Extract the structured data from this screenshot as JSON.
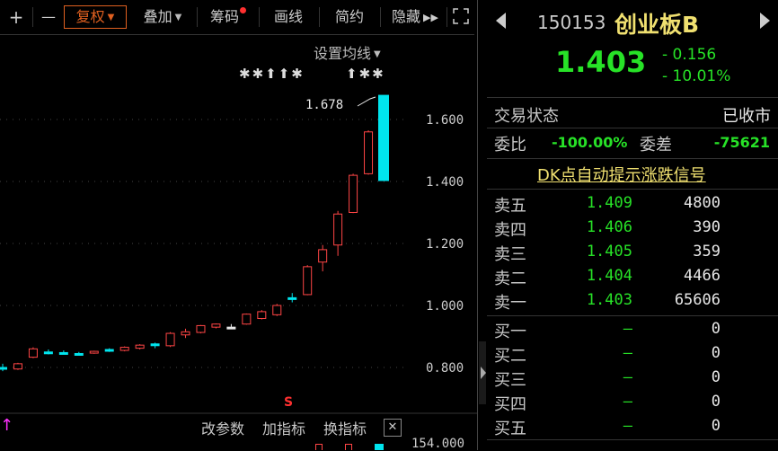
{
  "toolbar": {
    "plus": "+",
    "minus": "—",
    "fuquan": "复权",
    "diejia": "叠加",
    "chouma": "筹码",
    "huaxian": "画线",
    "jianyue": "简约",
    "yincang": "隐藏",
    "expand": "⛶"
  },
  "chart": {
    "settings_label": "设置均线",
    "marks_left": "✱✱⬆⬆✱",
    "marks_right": "⬆✱✱",
    "high_label": "1.678",
    "signal_label": "S",
    "bottom_left_arrow": "↑",
    "price_axis": [
      "1.600",
      "1.400",
      "1.200",
      "1.000",
      "0.800"
    ],
    "volume_axis_label": "154.000",
    "buttons": {
      "gaicanshu": "改参数",
      "jiazhibiao": "加指标",
      "huanzhibiao": "换指标",
      "close": "✕"
    },
    "candles": [
      {
        "o": 0.8,
        "c": 0.8,
        "h": 0.812,
        "l": 0.788,
        "color": "cyan"
      },
      {
        "o": 0.795,
        "c": 0.812,
        "h": 0.815,
        "l": 0.792,
        "color": "red"
      },
      {
        "o": 0.833,
        "c": 0.86,
        "h": 0.865,
        "l": 0.83,
        "color": "red"
      },
      {
        "o": 0.85,
        "c": 0.85,
        "h": 0.858,
        "l": 0.842,
        "color": "cyan"
      },
      {
        "o": 0.848,
        "c": 0.848,
        "h": 0.855,
        "l": 0.842,
        "color": "cyan"
      },
      {
        "o": 0.845,
        "c": 0.845,
        "h": 0.85,
        "l": 0.84,
        "color": "cyan"
      },
      {
        "o": 0.847,
        "c": 0.852,
        "h": 0.854,
        "l": 0.844,
        "color": "red"
      },
      {
        "o": 0.858,
        "c": 0.856,
        "h": 0.862,
        "l": 0.85,
        "color": "cyan"
      },
      {
        "o": 0.855,
        "c": 0.865,
        "h": 0.868,
        "l": 0.852,
        "color": "red"
      },
      {
        "o": 0.862,
        "c": 0.872,
        "h": 0.875,
        "l": 0.858,
        "color": "red"
      },
      {
        "o": 0.876,
        "c": 0.874,
        "h": 0.88,
        "l": 0.862,
        "color": "cyan"
      },
      {
        "o": 0.87,
        "c": 0.91,
        "h": 0.914,
        "l": 0.866,
        "color": "red"
      },
      {
        "o": 0.905,
        "c": 0.915,
        "h": 0.925,
        "l": 0.895,
        "color": "red"
      },
      {
        "o": 0.913,
        "c": 0.935,
        "h": 0.937,
        "l": 0.91,
        "color": "red"
      },
      {
        "o": 0.93,
        "c": 0.94,
        "h": 0.942,
        "l": 0.926,
        "color": "red"
      },
      {
        "o": 0.93,
        "c": 0.93,
        "h": 0.94,
        "l": 0.924,
        "color": "white"
      },
      {
        "o": 0.94,
        "c": 0.972,
        "h": 0.974,
        "l": 0.938,
        "color": "red"
      },
      {
        "o": 0.958,
        "c": 0.98,
        "h": 0.985,
        "l": 0.955,
        "color": "red"
      },
      {
        "o": 0.97,
        "c": 1.0,
        "h": 1.005,
        "l": 0.966,
        "color": "red"
      },
      {
        "o": 1.025,
        "c": 1.025,
        "h": 1.04,
        "l": 1.01,
        "color": "cyan"
      },
      {
        "o": 1.035,
        "c": 1.125,
        "h": 1.13,
        "l": 1.033,
        "color": "red"
      },
      {
        "o": 1.14,
        "c": 1.18,
        "h": 1.195,
        "l": 1.11,
        "color": "red"
      },
      {
        "o": 1.195,
        "c": 1.295,
        "h": 1.305,
        "l": 1.16,
        "color": "red"
      },
      {
        "o": 1.3,
        "c": 1.42,
        "h": 1.425,
        "l": 1.298,
        "color": "red"
      },
      {
        "o": 1.425,
        "c": 1.56,
        "h": 1.565,
        "l": 1.422,
        "color": "red"
      },
      {
        "o": 1.678,
        "c": 1.403,
        "h": 1.678,
        "l": 1.403,
        "color": "cyan"
      }
    ]
  },
  "quote": {
    "code": "150153",
    "name": "创业板B",
    "price": "1.403",
    "change": "- 0.156",
    "change_pct": "- 10.01%"
  },
  "status": {
    "label": "交易状态",
    "value": "已收市"
  },
  "weibi": {
    "label": "委比",
    "value": "-100.00%",
    "wc_label": "委差",
    "wc_value": "-75621"
  },
  "dk_link": "DK点自动提示涨跌信号",
  "orderbook": {
    "sell": [
      {
        "label": "卖五",
        "price": "1.409",
        "vol": "4800"
      },
      {
        "label": "卖四",
        "price": "1.406",
        "vol": "390"
      },
      {
        "label": "卖三",
        "price": "1.405",
        "vol": "359"
      },
      {
        "label": "卖二",
        "price": "1.404",
        "vol": "4466"
      },
      {
        "label": "卖一",
        "price": "1.403",
        "vol": "65606"
      }
    ],
    "buy": [
      {
        "label": "买一",
        "price": "—",
        "vol": "0"
      },
      {
        "label": "买二",
        "price": "—",
        "vol": "0"
      },
      {
        "label": "买三",
        "price": "—",
        "vol": "0"
      },
      {
        "label": "买四",
        "price": "—",
        "vol": "0"
      },
      {
        "label": "买五",
        "price": "—",
        "vol": "0"
      }
    ]
  },
  "colors": {
    "up": "#ff4545",
    "down": "#00e5ee",
    "green": "#27e227",
    "accent": "#e06020"
  }
}
